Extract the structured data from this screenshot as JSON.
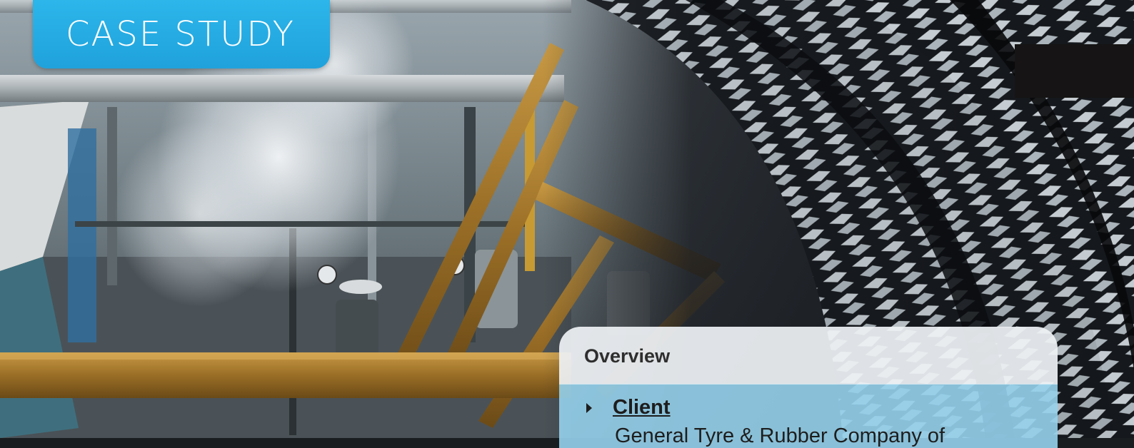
{
  "header": {
    "case_study_label": "CASE STUDY"
  },
  "overview": {
    "title": "Overview",
    "items": [
      {
        "label": "Client",
        "text": "General Tyre & Rubber Company of"
      }
    ]
  },
  "icons": {
    "bullet": "triangle-right-icon"
  },
  "colors": {
    "accent": "#22a8e0",
    "overview_header_bg": "#eef1f4",
    "overview_body_bg": "#96d2ec",
    "text_dark": "#1d1d1d"
  }
}
